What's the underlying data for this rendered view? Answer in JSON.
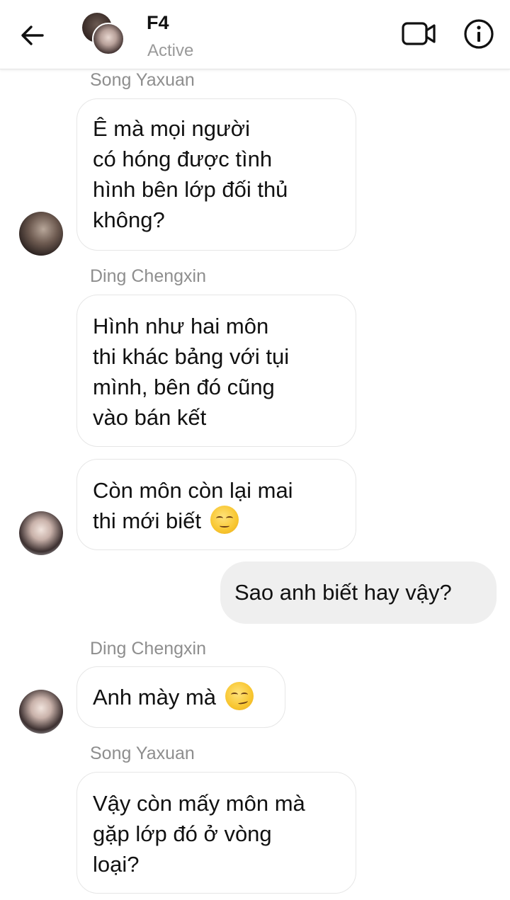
{
  "header": {
    "title": "F4",
    "status": "Active"
  },
  "messages": [
    {
      "sender": "Song Yaxuan",
      "text": "Ê mà mọi người\ncó hóng được tình\nhình bên lớp đối thủ\nkhông?"
    },
    {
      "sender": "Ding Chengxin",
      "text": "Hình như hai môn\nthi khác bảng với tụi\nmình, bên đó cũng\nvào bán kết"
    },
    {
      "text_line1": "Còn môn còn lại mai",
      "text_line2": "thi mới biết",
      "emoji": "relieved-face"
    },
    {
      "outgoing": "Sao anh biết hay vậy?"
    },
    {
      "sender": "Ding Chengxin",
      "text": "Anh mày mà",
      "emoji": "smirking-face"
    },
    {
      "sender": "Song Yaxuan",
      "text": "Vậy còn mấy môn mà\ngặp lớp đó ở vòng\nloại?"
    }
  ],
  "colors": {
    "incoming_bubble_border": "#e6e6e6",
    "outgoing_bubble": "#efefef",
    "sender_name": "#8e8e8e",
    "status_text": "#9a9a9a"
  }
}
